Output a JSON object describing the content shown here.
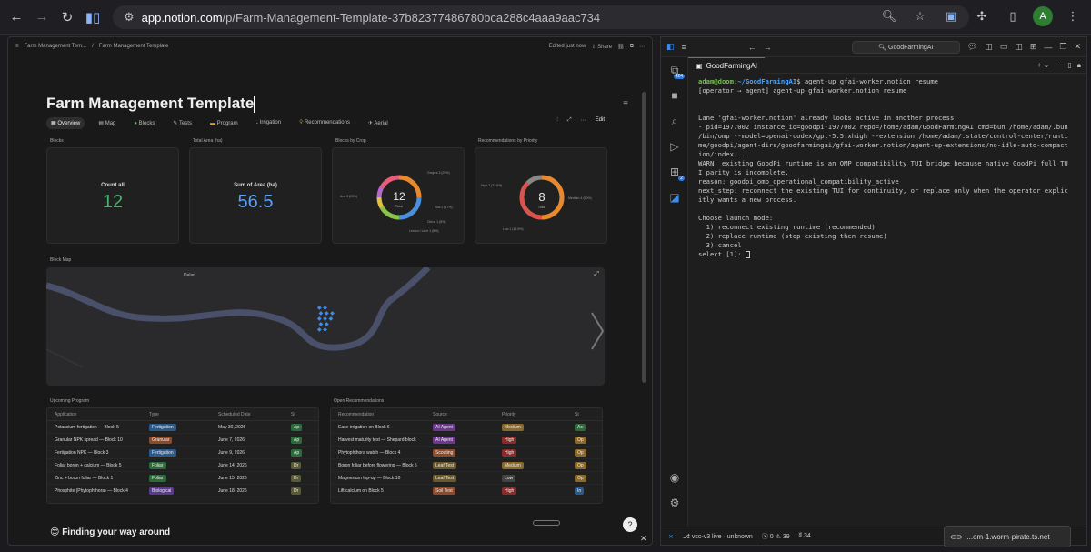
{
  "browser": {
    "url_host": "app.notion.com",
    "url_path": "/p/Farm-Management-Template-37b82377486780bca288c4aaa9aac734",
    "profile_initial": "A"
  },
  "notion": {
    "breadcrumb_1": "Farm Management Tem...",
    "breadcrumb_2": "Farm Management Template",
    "edited": "Edited just now",
    "share": "Share",
    "title": "Farm Management Template",
    "tabs": [
      "Overview",
      "Map",
      "Blocks",
      "Tests",
      "Program",
      "Irrigation",
      "Recommendations",
      "Aerial"
    ],
    "edit": "Edit",
    "cards": {
      "blocks_label": "Blocks",
      "blocks_stat_label": "Count all",
      "blocks_stat_value": "12",
      "area_label": "Total Area (ha)",
      "area_stat_label": "Sum of Area (ha)",
      "area_stat_value": "56.5",
      "crop_label": "Blocks by Crop",
      "crop_total": "12",
      "crop_total_label": "Total",
      "crop_legend": [
        "Grapes 3 (25%)",
        "Avo 3 (25%)",
        "Kiwi 2 (17%)",
        "Citrus 1 (8%)",
        "Lemon / Lime 1 (8%)"
      ],
      "rec_label": "Recommendations by Priority",
      "rec_total": "8",
      "rec_total_label": "Total",
      "rec_legend": [
        "High 3 (37.5%)",
        "Medium 4 (50%)",
        "Low 1 (12.5%)"
      ]
    },
    "map_label": "Block Map",
    "map_place": "Dalan",
    "upcoming": {
      "label": "Upcoming Program",
      "headers": [
        "Application",
        "Type",
        "Scheduled Date",
        "St"
      ],
      "rows": [
        {
          "name": "Potassium fertigation — Block 5",
          "type": "Fertigation",
          "date": "May 30, 2026",
          "st": "Ap"
        },
        {
          "name": "Granular NPK spread — Block 10",
          "type": "Granular",
          "date": "June 7, 2026",
          "st": "Ap"
        },
        {
          "name": "Fertigation NPK — Block 3",
          "type": "Fertigation",
          "date": "June 9, 2026",
          "st": "Ap"
        },
        {
          "name": "Foliar boron + calcium — Block 5",
          "type": "Foliar",
          "date": "June 14, 2026",
          "st": "Dr"
        },
        {
          "name": "Zinc + boron foliar — Block 1",
          "type": "Foliar",
          "date": "June 15, 2026",
          "st": "Dr"
        },
        {
          "name": "Phosphite (Phytophthora) — Block 4",
          "type": "Biological",
          "date": "June 18, 2026",
          "st": "Dr"
        }
      ]
    },
    "open_recs": {
      "label": "Open Recommendations",
      "headers": [
        "Recommendation",
        "Source",
        "Priority",
        "St"
      ],
      "rows": [
        {
          "name": "Ease irrigation on Block 6",
          "source": "AI Agent",
          "priority": "Medium",
          "st": "Ac"
        },
        {
          "name": "Harvest maturity test — Shepard block",
          "source": "AI Agent",
          "priority": "High",
          "st": "Op"
        },
        {
          "name": "Phytophthora watch — Block 4",
          "source": "Scouting",
          "priority": "High",
          "st": "Op"
        },
        {
          "name": "Boron foliar before flowering — Block 5",
          "source": "Leaf Test",
          "priority": "Medium",
          "st": "Op"
        },
        {
          "name": "Magnesium top-up — Block 10",
          "source": "Leaf Test",
          "priority": "Low",
          "st": "Op"
        },
        {
          "name": "Lift calcium on Block 5",
          "source": "Soil Test",
          "priority": "High",
          "st": "In"
        }
      ]
    },
    "finding": "Finding your way around"
  },
  "vscode": {
    "search": "GoodFarmingAI",
    "tab": "GoodFarmingAI",
    "badge_1": "424",
    "badge_2": "2",
    "prompt_user": "adam@doom",
    "prompt_path": "~/GoodFarmingAI",
    "prompt_cmd": "$ agent-up gfai-worker.notion resume",
    "lines": [
      "[operator → agent] agent-up gfai-worker.notion resume",
      "",
      "",
      "Lane 'gfai-worker.notion' already looks active in another process:",
      "- pid=1977002 instance_id=goodpi-1977002 repo=/home/adam/GoodFarmingAI cmd=bun /home/adam/.bun",
      "/bin/omp --model=openai-codex/gpt-5.5:xhigh --extension /home/adam/.state/control-center/runti",
      "me/goodpi/agent-dirs/goodfarmingai/gfai-worker.notion/agent-up-extensions/no-idle-auto-compact",
      "ion/index....",
      "WARN: existing GoodPi runtime is an OMP compatibility TUI bridge because native GoodPi full TU",
      "I parity is incomplete.",
      "reason: goodpi_omp_operational_compatibility_active",
      "next_step: reconnect the existing TUI for continuity, or replace only when the operator explic",
      "itly wants a new process.",
      "",
      "Choose launch mode:",
      "  1) reconnect existing runtime (recommended)",
      "  2) replace runtime (stop existing then resume)",
      "  3) cancel"
    ],
    "select": "select [1]: ",
    "status_remote": "vsc-v3 live · unknown",
    "status_errors": "0",
    "status_warnings": "39",
    "status_ports": "34",
    "toast": "...om-1.worm-pirate.ts.net"
  }
}
